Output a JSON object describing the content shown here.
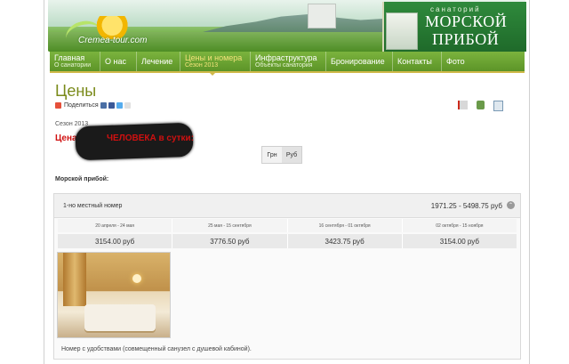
{
  "header": {
    "left_logo_text": "Cremea-tour.com",
    "right_logo_small": "санаторий",
    "right_logo_line1": "МОРСКОЙ",
    "right_logo_line2": "ПРИБОЙ"
  },
  "nav": {
    "items": [
      {
        "label": "Главная",
        "sub": "О санатории"
      },
      {
        "label": "О нас",
        "sub": ""
      },
      {
        "label": "Лечение",
        "sub": ""
      },
      {
        "label": "Цены и номера",
        "sub": "Сезон 2013"
      },
      {
        "label": "Инфраструктура",
        "sub": "Объекты санатория"
      },
      {
        "label": "Бронирование",
        "sub": ""
      },
      {
        "label": "Контакты",
        "sub": ""
      },
      {
        "label": "Фото",
        "sub": ""
      }
    ]
  },
  "page": {
    "title": "Цены",
    "share_label": "Поделиться",
    "season": "Сезон 2013",
    "price_heading_prefix": "Цена с",
    "price_heading_visible": "ЧЕЛОВЕКА в сутки:",
    "currency": {
      "options": [
        "Грн",
        "Руб"
      ],
      "selected": "Руб"
    },
    "section_title": "Морской прибой:"
  },
  "room": {
    "name": "1-но местный номер",
    "range": "1971.25 - 5498.75 руб",
    "periods": [
      "20 апреля - 24 мая",
      "25 мая - 15 сентября",
      "16 сентября - 01 октября",
      "02 октября - 15 ноября"
    ],
    "prices": [
      "3154.00 руб",
      "3776.50 руб",
      "3423.75 руб",
      "3154.00 руб"
    ],
    "description": "Номер с удобствами (совмещенный санузел с душевой кабиной)."
  }
}
